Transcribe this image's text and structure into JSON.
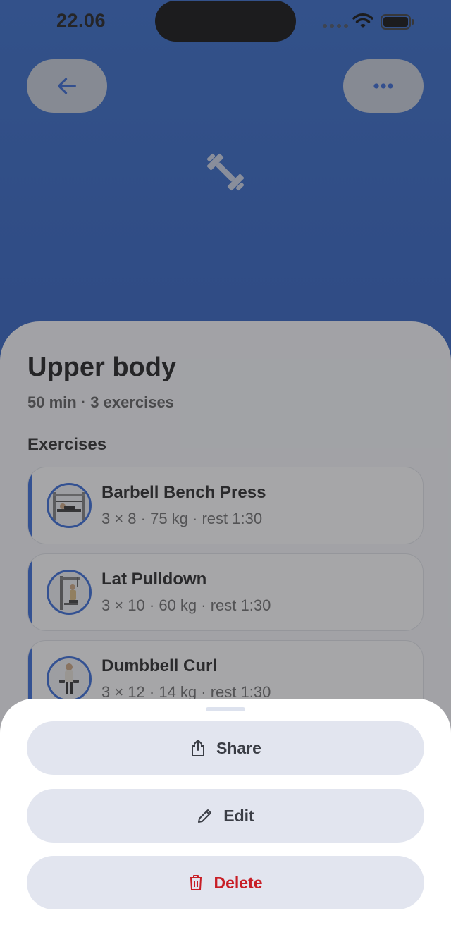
{
  "status_bar": {
    "time": "22.06"
  },
  "workout": {
    "title": "Upper body",
    "subtitle": "50 min · 3 exercises",
    "section_label": "Exercises"
  },
  "exercises": [
    {
      "name": "Barbell Bench Press",
      "meta": "3 × 8 · 75 kg · rest 1:30"
    },
    {
      "name": "Lat Pulldown",
      "meta": "3 × 10 · 60 kg · rest 1:30"
    },
    {
      "name": "Dumbbell Curl",
      "meta": "3 × 12 · 14 kg · rest 1:30"
    }
  ],
  "sheet": {
    "share_label": "Share",
    "edit_label": "Edit",
    "delete_label": "Delete"
  },
  "colors": {
    "accent": "#2c63d6",
    "danger": "#c81e26",
    "header_gradient_top": "#2b63c7",
    "header_gradient_bottom": "#1e4aa3"
  },
  "icons": {
    "back": "arrow-left-icon",
    "more": "more-horizontal-icon",
    "hero": "dumbbell-icon",
    "share": "share-icon",
    "edit": "pencil-icon",
    "delete": "trash-icon"
  }
}
